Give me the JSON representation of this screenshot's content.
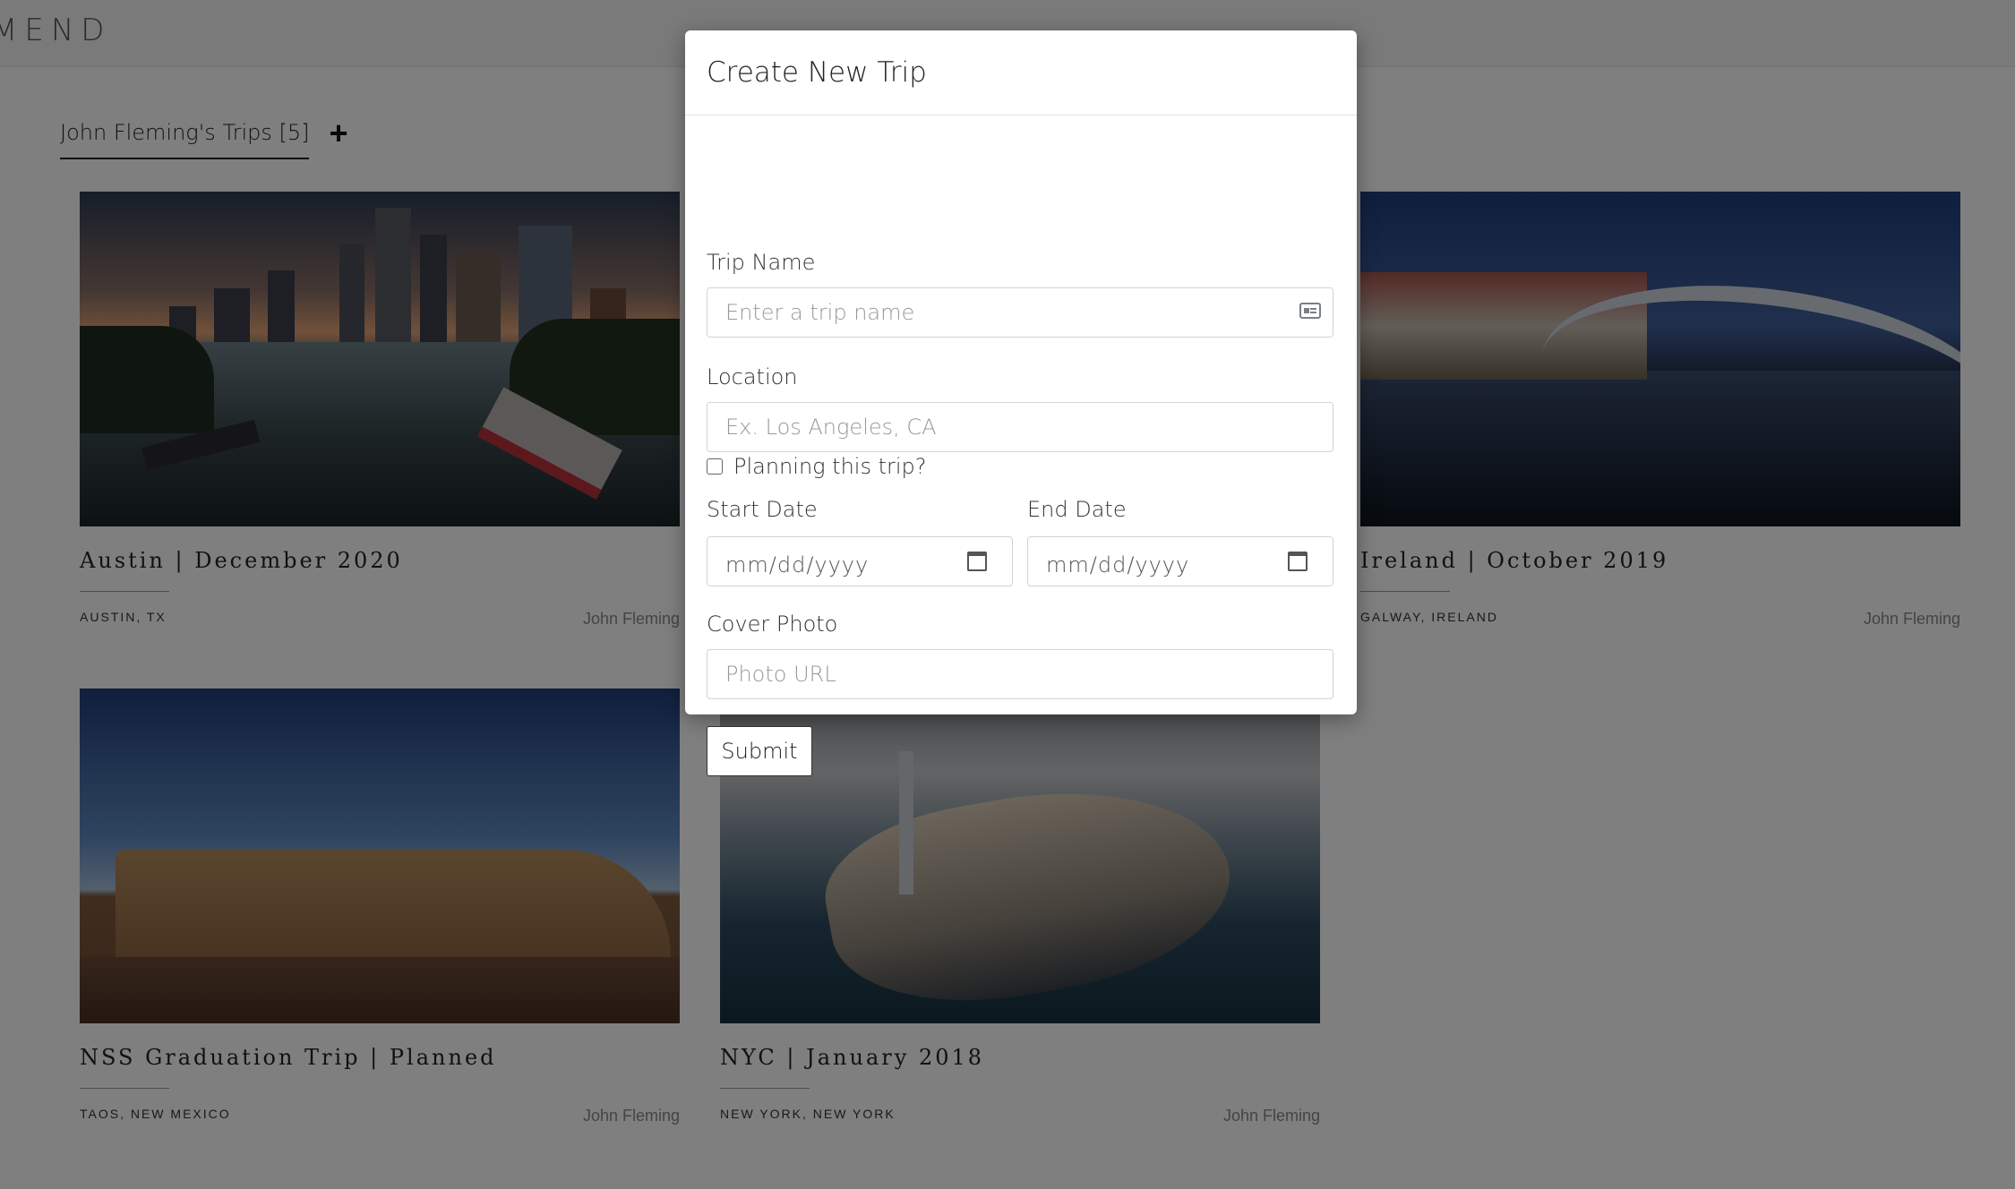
{
  "app": {
    "brand": "MEND"
  },
  "tabs": {
    "active_label": "John Fleming's Trips [5]",
    "add_icon": "plus-icon"
  },
  "trips": [
    {
      "title": "Austin | December 2020",
      "location": "AUSTIN, TX",
      "owner": "John Fleming"
    },
    {
      "title": "Ireland | October 2019",
      "location": "GALWAY, IRELAND",
      "owner": "John Fleming"
    },
    {
      "title": "NSS Graduation Trip | Planned",
      "location": "TAOS, NEW MEXICO",
      "owner": "John Fleming"
    },
    {
      "title": "NYC | January 2018",
      "location": "NEW YORK, NEW YORK",
      "owner": "John Fleming"
    }
  ],
  "modal": {
    "title": "Create New Trip",
    "trip_name_label": "Trip Name",
    "trip_name_placeholder": "Enter a trip name",
    "location_label": "Location",
    "location_placeholder": "Ex. Los Angeles, CA",
    "planning_label": "Planning this trip?",
    "planning_checked": false,
    "start_date_label": "Start Date",
    "start_date_value": "mm/dd/yyyy",
    "end_date_label": "End Date",
    "end_date_value": "mm/dd/yyyy",
    "cover_label": "Cover Photo",
    "cover_placeholder": "Photo URL",
    "submit_label": "Submit"
  }
}
